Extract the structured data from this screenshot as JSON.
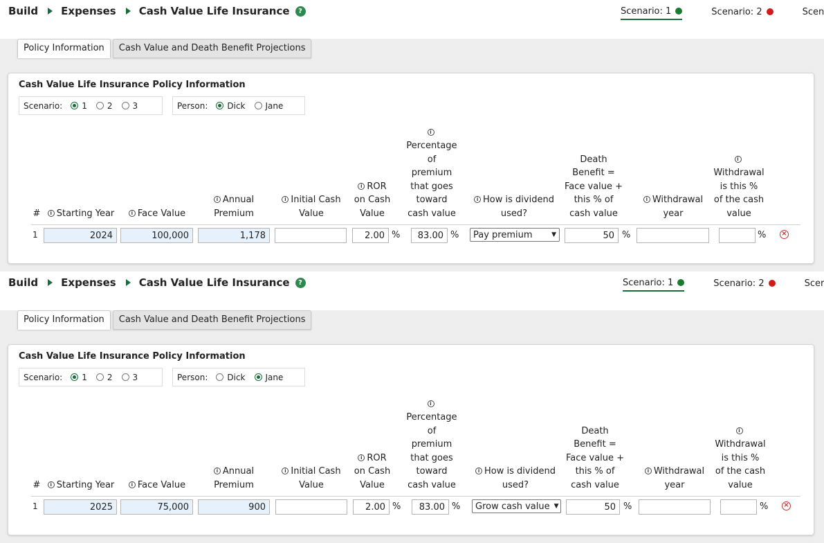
{
  "panels": [
    {
      "breadcrumb": [
        "Build",
        "Expenses",
        "Cash Value Life Insurance"
      ],
      "scenario_tabs": [
        {
          "label": "Scenario: 1",
          "status_color": "#1a7a2e"
        },
        {
          "label": "Scenario: 2",
          "status_color": "#d11a1a"
        },
        {
          "label": "Scen"
        }
      ],
      "page_tabs": [
        "Policy Information",
        "Cash Value and Death Benefit Projections"
      ],
      "card_title": "Cash Value Life Insurance Policy Information",
      "scenario_select": {
        "label": "Scenario:",
        "options": [
          "1",
          "2",
          "3"
        ],
        "selected": "1"
      },
      "person_select": {
        "label": "Person:",
        "options": [
          "Dick",
          "Jane"
        ],
        "selected": "Dick"
      },
      "columns": {
        "num": "#",
        "starting_year": "Starting Year",
        "face_value": "Face Value",
        "annual_premium": [
          "Annual",
          "Premium"
        ],
        "initial_cash_value": [
          "Initial Cash",
          "Value"
        ],
        "ror": [
          "ROR",
          "on Cash",
          "Value"
        ],
        "pct_premium": [
          "Percentage",
          "of",
          "premium",
          "that goes",
          "toward",
          "cash value"
        ],
        "dividend": [
          "How is dividend",
          "used?"
        ],
        "death_benefit": [
          "Death",
          "Benefit =",
          "Face value +",
          "this % of",
          "cash value"
        ],
        "withdrawal_year": [
          "Withdrawal",
          "year"
        ],
        "withdrawal_pct": [
          "Withdrawal",
          "is this %",
          "of the cash",
          "value"
        ]
      },
      "row": {
        "num": "1",
        "starting_year": "2024",
        "face_value": "100,000",
        "annual_premium": "1,178",
        "initial_cash_value": "",
        "ror": "2.00",
        "pct_premium": "83.00",
        "dividend": "Pay premium",
        "death_benefit_pct": "50",
        "withdrawal_year": "",
        "withdrawal_pct": "",
        "pct_symbol": "%"
      }
    },
    {
      "breadcrumb": [
        "Build",
        "Expenses",
        "Cash Value Life Insurance"
      ],
      "scenario_tabs": [
        {
          "label": "Scenario: 1",
          "status_color": "#1a7a2e"
        },
        {
          "label": "Scenario: 2",
          "status_color": "#d11a1a"
        },
        {
          "label": "Scer"
        }
      ],
      "page_tabs": [
        "Policy Information",
        "Cash Value and Death Benefit Projections"
      ],
      "card_title": "Cash Value Life Insurance Policy Information",
      "scenario_select": {
        "label": "Scenario:",
        "options": [
          "1",
          "2",
          "3"
        ],
        "selected": "1"
      },
      "person_select": {
        "label": "Person:",
        "options": [
          "Dick",
          "Jane"
        ],
        "selected": "Jane"
      },
      "columns": {
        "num": "#",
        "starting_year": "Starting Year",
        "face_value": "Face Value",
        "annual_premium": [
          "Annual",
          "Premium"
        ],
        "initial_cash_value": [
          "Initial Cash",
          "Value"
        ],
        "ror": [
          "ROR",
          "on Cash",
          "Value"
        ],
        "pct_premium": [
          "Percentage",
          "of",
          "premium",
          "that goes",
          "toward",
          "cash value"
        ],
        "dividend": [
          "How is dividend",
          "used?"
        ],
        "death_benefit": [
          "Death",
          "Benefit =",
          "Face value +",
          "this % of",
          "cash value"
        ],
        "withdrawal_year": [
          "Withdrawal",
          "year"
        ],
        "withdrawal_pct": [
          "Withdrawal",
          "is this %",
          "of the cash",
          "value"
        ]
      },
      "row": {
        "num": "1",
        "starting_year": "2025",
        "face_value": "75,000",
        "annual_premium": "900",
        "initial_cash_value": "",
        "ror": "2.00",
        "pct_premium": "83.00",
        "dividend": "Grow cash value",
        "death_benefit_pct": "50",
        "withdrawal_year": "",
        "withdrawal_pct": "",
        "pct_symbol": "%"
      }
    }
  ]
}
